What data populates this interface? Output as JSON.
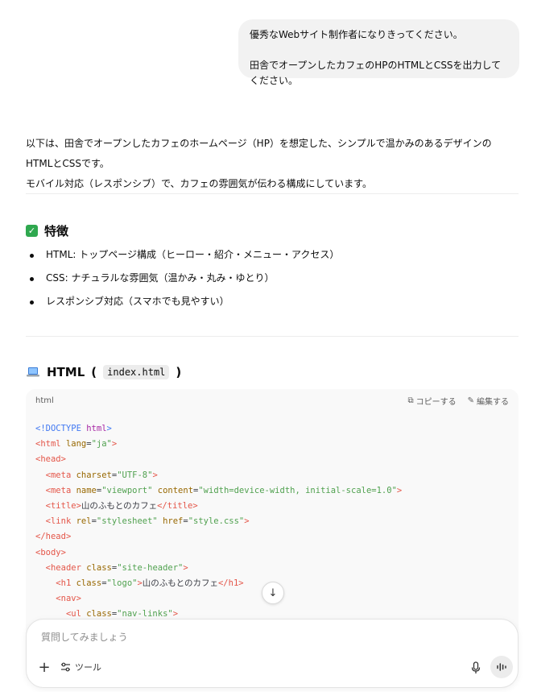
{
  "user_message": {
    "line1": "優秀なWebサイト制作者になりきってください。",
    "line2": "田舎でオープンしたカフェのHPのHTMLとCSSを出力してください。"
  },
  "assistant": {
    "intro_line1": "以下は、田舎でオープンしたカフェのホームページ（HP）を想定した、シンプルで温かみのあるデザインのHTMLとCSSです。",
    "intro_line2": "モバイル対応（レスポンシブ）で、カフェの雰囲気が伝わる構成にしています。",
    "features_title": "特徴",
    "features": [
      "HTML: トップページ構成（ヒーロー・紹介・メニュー・アクセス）",
      "CSS: ナチュラルな雰囲気（温かみ・丸み・ゆとり）",
      "レスポンシブ対応（スマホでも見やすい）"
    ],
    "html_title": "HTML",
    "html_filename": "index.html"
  },
  "code_block": {
    "language": "html",
    "copy_label": "コピーする",
    "edit_label": "編集する",
    "lines": [
      "<!DOCTYPE html>",
      "<html lang=\"ja\">",
      "<head>",
      "  <meta charset=\"UTF-8\">",
      "  <meta name=\"viewport\" content=\"width=device-width, initial-scale=1.0\">",
      "  <title>山のふもとのカフェ</title>",
      "  <link rel=\"stylesheet\" href=\"style.css\">",
      "</head>",
      "<body>",
      "  <header class=\"site-header\">",
      "    <h1 class=\"logo\">山のふもとのカフェ</h1>",
      "    <nav>",
      "      <ul class=\"nav-links\">"
    ]
  },
  "composer": {
    "placeholder": "質問してみましょう",
    "tools_label": "ツール"
  },
  "icons": {
    "features": "check-icon",
    "html": "laptop-icon",
    "copy": "copy-icon",
    "edit": "edit-icon",
    "scroll": "arrow-down-icon",
    "plus": "plus-icon",
    "tools": "sliders-icon",
    "mic": "mic-icon",
    "voice": "voice-wave-icon"
  },
  "colors": {
    "check": "#2fa84f",
    "bubble": "#f2f2f2",
    "code_bg": "#f9f9f9"
  }
}
